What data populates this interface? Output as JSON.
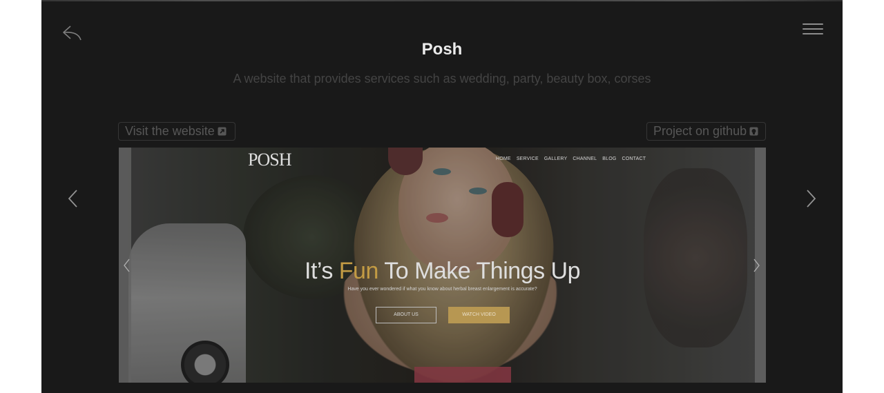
{
  "project": {
    "title": "Posh",
    "description": "A website that provides services such as wedding, party, beauty box, corses",
    "visit_label": "Visit the website",
    "github_label": "Project on github"
  },
  "icons": {
    "back": "reply-arrow-icon",
    "menu": "hamburger-menu-icon",
    "external": "external-link-icon",
    "github": "github-icon",
    "prev": "chevron-left-icon",
    "next": "chevron-right-icon"
  },
  "preview": {
    "logo": "POSH",
    "nav": [
      "HOME",
      "SERVICE",
      "GALLERY",
      "CHANNEL",
      "BLOG",
      "CONTACT"
    ],
    "headline_before": "It’s ",
    "headline_highlight": "Fun",
    "headline_after": " To Make Things Up",
    "tagline": "Have you ever wondered if what you know about herbal breast enlargement is accurate?",
    "button_about": "ABOUT US",
    "button_video": "WATCH VIDEO"
  },
  "colors": {
    "panel_bg": "#1c1c1c",
    "title": "#ffffff",
    "muted": "#4a4a4a",
    "accent_gold": "#c7a45a"
  }
}
